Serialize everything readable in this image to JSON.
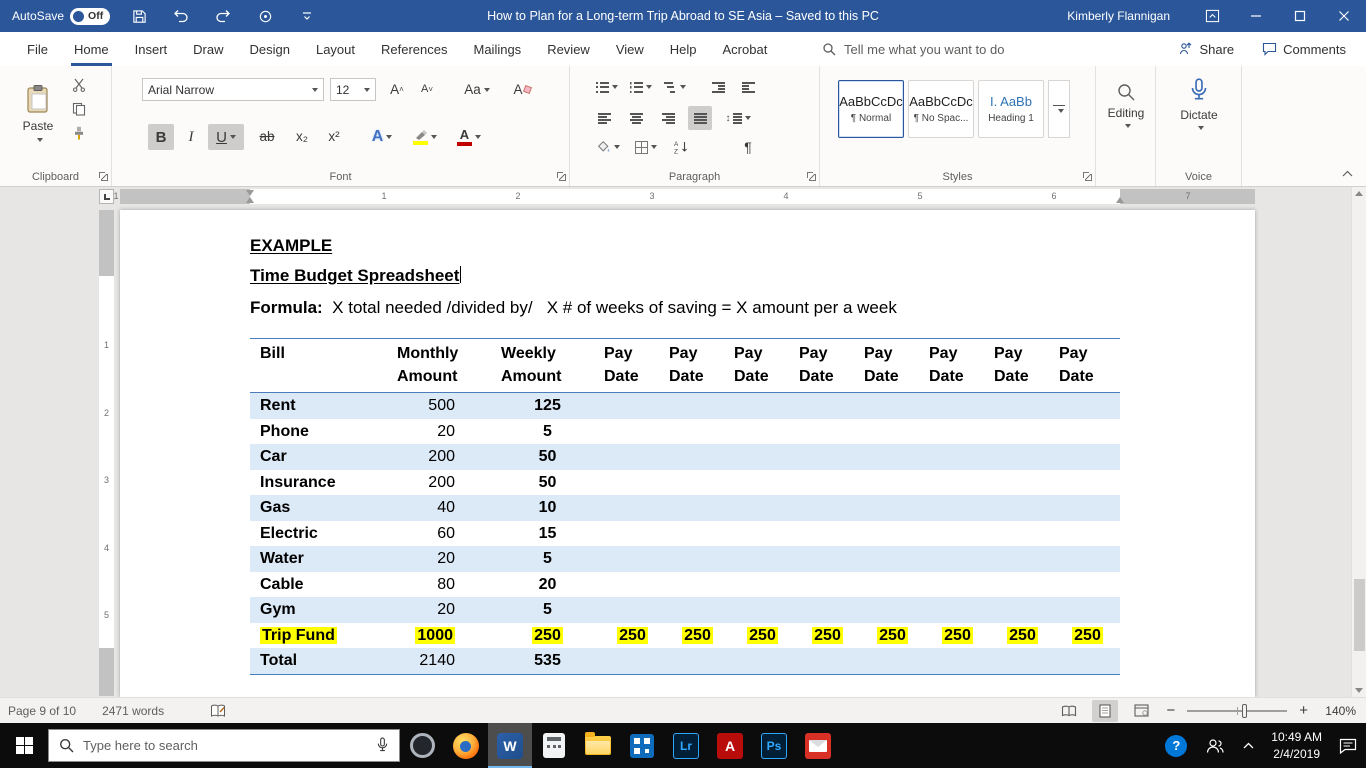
{
  "window": {
    "autosave_label": "AutoSave",
    "autosave_state": "Off",
    "title": "How to Plan for a Long-term Trip Abroad to SE Asia  –  Saved to this PC",
    "user_name": "Kimberly Flannigan"
  },
  "menubar": {
    "tabs": [
      "File",
      "Home",
      "Insert",
      "Draw",
      "Design",
      "Layout",
      "References",
      "Mailings",
      "Review",
      "View",
      "Help",
      "Acrobat"
    ],
    "active_tab": "Home",
    "tell_me_placeholder": "Tell me what you want to do",
    "share_label": "Share",
    "comments_label": "Comments"
  },
  "ribbon": {
    "clipboard_group": {
      "label": "Clipboard",
      "paste_label": "Paste"
    },
    "font_group": {
      "label": "Font",
      "font_name": "Arial Narrow",
      "font_size": "12",
      "grow_font": "A",
      "shrink_font": "A",
      "change_case": "Aa",
      "clear_formatting": "A",
      "bold": "B",
      "italic": "I",
      "underline": "U",
      "strikethrough": "ab",
      "subscript": "x₂",
      "superscript": "x²",
      "text_effects": "A"
    },
    "paragraph_group": {
      "label": "Paragraph",
      "pilcrow": "¶",
      "sort_a": "A",
      "sort_z": "Z",
      "line_spacing_arrows": "↕"
    },
    "styles_group": {
      "label": "Styles",
      "styles": [
        {
          "preview": "AaBbCcDc",
          "name": "¶ Normal",
          "selected": true
        },
        {
          "preview": "AaBbCcDc",
          "name": "¶ No Spac...",
          "selected": false
        },
        {
          "preview": "I. AaBb",
          "name": "Heading 1",
          "selected": false
        }
      ]
    },
    "editing_group": {
      "label": "Editing"
    },
    "voice_group": {
      "label": "Voice",
      "dictate_label": "Dictate"
    }
  },
  "ruler": {
    "h_numbers": [
      "1",
      "1",
      "2",
      "3",
      "4",
      "5",
      "6",
      "7"
    ],
    "v_numbers": [
      "1",
      "2",
      "3",
      "4",
      "5"
    ]
  },
  "document": {
    "heading_line1": "EXAMPLE",
    "heading_line2": "Time Budget Spreadsheet",
    "formula_label": "Formula:",
    "formula_text": "  X total needed /divided by/   X # of weeks of saving = X amount per a week",
    "table": {
      "columns": {
        "bill": "Bill",
        "monthly": [
          "Monthly",
          "Amount"
        ],
        "weekly": [
          "Weekly",
          "Amount"
        ],
        "pay": [
          "Pay",
          "Date"
        ],
        "pay_columns": 8
      },
      "rows": [
        {
          "bill": "Rent",
          "monthly": "500",
          "weekly": "125",
          "shaded": true,
          "highlight": false
        },
        {
          "bill": "Phone",
          "monthly": "20",
          "weekly": "5",
          "shaded": false,
          "highlight": false
        },
        {
          "bill": "Car",
          "monthly": "200",
          "weekly": "50",
          "shaded": true,
          "highlight": false
        },
        {
          "bill": "Insurance",
          "monthly": "200",
          "weekly": "50",
          "shaded": false,
          "highlight": false
        },
        {
          "bill": "Gas",
          "monthly": "40",
          "weekly": "10",
          "shaded": true,
          "highlight": false
        },
        {
          "bill": "Electric",
          "monthly": "60",
          "weekly": "15",
          "shaded": false,
          "highlight": false
        },
        {
          "bill": "Water",
          "monthly": "20",
          "weekly": "5",
          "shaded": true,
          "highlight": false
        },
        {
          "bill": "Cable",
          "monthly": "80",
          "weekly": "20",
          "shaded": false,
          "highlight": false
        },
        {
          "bill": "Gym",
          "monthly": "20",
          "weekly": "5",
          "shaded": true,
          "highlight": false
        },
        {
          "bill": "Trip Fund",
          "monthly": "1000",
          "weekly": "250",
          "pay": [
            "250",
            "250",
            "250",
            "250",
            "250",
            "250",
            "250",
            "250"
          ],
          "shaded": false,
          "highlight": true
        },
        {
          "bill": "Total",
          "monthly": "2140",
          "weekly": "535",
          "shaded": true,
          "highlight": false
        }
      ]
    }
  },
  "statusbar": {
    "page_indicator": "Page 9 of 10",
    "word_count": "2471 words",
    "zoom_level": "140%"
  },
  "taskbar": {
    "search_placeholder": "Type here to search",
    "apps": [
      {
        "id": "circle-app",
        "glyph": "",
        "active": false
      },
      {
        "id": "firefox",
        "glyph": "",
        "active": false
      },
      {
        "id": "word",
        "glyph": "W",
        "active": true
      },
      {
        "id": "calculator",
        "glyph": "",
        "active": false
      },
      {
        "id": "file-explorer",
        "glyph": "",
        "active": false
      },
      {
        "id": "qr-app",
        "glyph": "",
        "active": false
      },
      {
        "id": "lightroom",
        "glyph": "Lr",
        "active": false
      },
      {
        "id": "acrobat",
        "glyph": "A",
        "active": false
      },
      {
        "id": "photoshop",
        "glyph": "Ps",
        "active": false
      },
      {
        "id": "mail",
        "glyph": "",
        "active": false
      }
    ],
    "tray": {
      "help_glyph": "?",
      "time": "10:49 AM",
      "date": "2/4/2019"
    }
  },
  "colors": {
    "accent": "#2b579a",
    "table_shade": "#dce9f6",
    "highlight": "#ffff00",
    "table_border": "#4a7dbb",
    "taskbar": "#0c0c0c"
  }
}
